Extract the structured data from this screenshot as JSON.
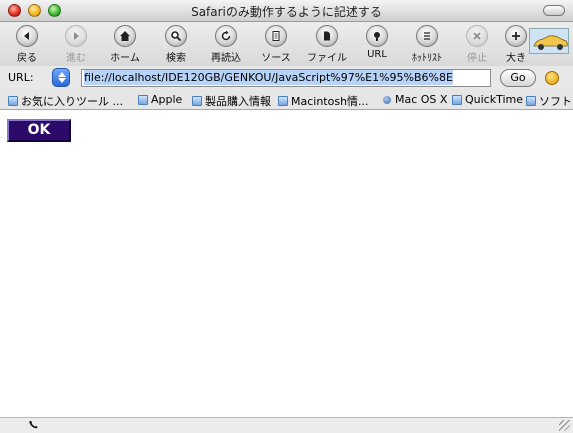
{
  "window": {
    "title": "Safariのみ動作するように記述する"
  },
  "toolbar": {
    "buttons": [
      {
        "label": "戻る",
        "icon": "back-arrow-icon"
      },
      {
        "label": "進む",
        "icon": "forward-arrow-icon"
      },
      {
        "label": "ホーム",
        "icon": "home-icon"
      },
      {
        "label": "検索",
        "icon": "search-icon"
      },
      {
        "label": "再読込",
        "icon": "reload-icon"
      },
      {
        "label": "ソース",
        "icon": "source-icon"
      },
      {
        "label": "ファイル",
        "icon": "file-icon"
      },
      {
        "label": "URL",
        "icon": "url-icon"
      },
      {
        "label": "ﾎｯﾄﾘｽﾄ",
        "icon": "hotlist-icon"
      },
      {
        "label": "停止",
        "icon": "stop-icon"
      },
      {
        "label": "大き",
        "icon": "bigger-text-icon"
      }
    ]
  },
  "urlbar": {
    "label": "URL:",
    "value": "file://localhost/IDE120GB/GENKOU/JavaScript%97%E1%95%B6%8E",
    "go_label": "Go"
  },
  "bookmarks": {
    "items": [
      "お気に入りツール ...",
      "Apple",
      "製品購入情報",
      "Macintosh情...",
      "Mac OS X",
      "QuickTime",
      "ソフト"
    ]
  },
  "content": {
    "ok_label": "OK"
  },
  "status": {
    "icon": "phone-icon"
  }
}
